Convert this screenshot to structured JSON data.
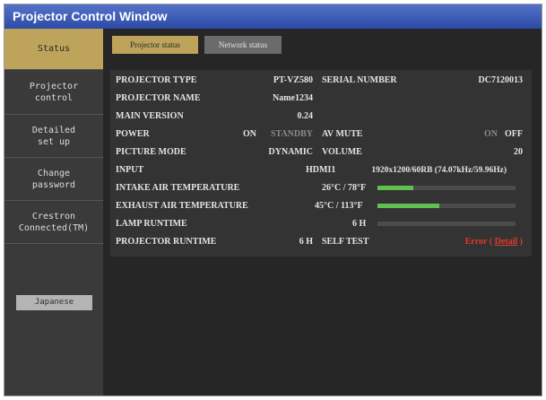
{
  "window": {
    "title": "Projector Control Window"
  },
  "sidebar": {
    "items": [
      {
        "label": "Status"
      },
      {
        "label": "Projector\ncontrol"
      },
      {
        "label": "Detailed\nset up"
      },
      {
        "label": "Change\npassword"
      },
      {
        "label": "Crestron\nConnected(TM)"
      }
    ],
    "language_button": "Japanese"
  },
  "tabs": {
    "projector_status": "Projector status",
    "network_status": "Network status"
  },
  "status": {
    "projector_type": {
      "label": "PROJECTOR TYPE",
      "value": "PT-VZ580"
    },
    "serial_number": {
      "label": "SERIAL NUMBER",
      "value": "DC7120013"
    },
    "projector_name": {
      "label": "PROJECTOR NAME",
      "value": "Name1234"
    },
    "main_version": {
      "label": "MAIN VERSION",
      "value": "0.24"
    },
    "power": {
      "label": "POWER",
      "on": "ON",
      "standby": "STANDBY"
    },
    "av_mute": {
      "label": "AV MUTE",
      "on": "ON",
      "off": "OFF"
    },
    "picture_mode": {
      "label": "PICTURE MODE",
      "value": "DYNAMIC"
    },
    "volume": {
      "label": "VOLUME",
      "value": "20"
    },
    "input": {
      "label": "INPUT",
      "source": "HDMI1",
      "signal": "1920x1200/60RB (74.07kHz/59.96Hz)"
    },
    "intake_temp": {
      "label": "INTAKE AIR TEMPERATURE",
      "value": "26°C / 78°F",
      "level": 0.26
    },
    "exhaust_temp": {
      "label": "EXHAUST AIR TEMPERATURE",
      "value": "45°C / 113°F",
      "level": 0.45
    },
    "lamp_runtime": {
      "label": "LAMP RUNTIME",
      "value": "6 H",
      "level": 0.0
    },
    "projector_runtime": {
      "label": "PROJECTOR RUNTIME",
      "value": "6 H"
    },
    "self_test": {
      "label": "SELF TEST",
      "status": "Error",
      "open_paren": "(",
      "link": "Detail",
      "close_paren": ")"
    }
  },
  "colors": {
    "accent": "#bda45a",
    "title_bar": "#3a5cbf",
    "bar_fill": "#5fbf4f",
    "error": "#e23a2a"
  }
}
